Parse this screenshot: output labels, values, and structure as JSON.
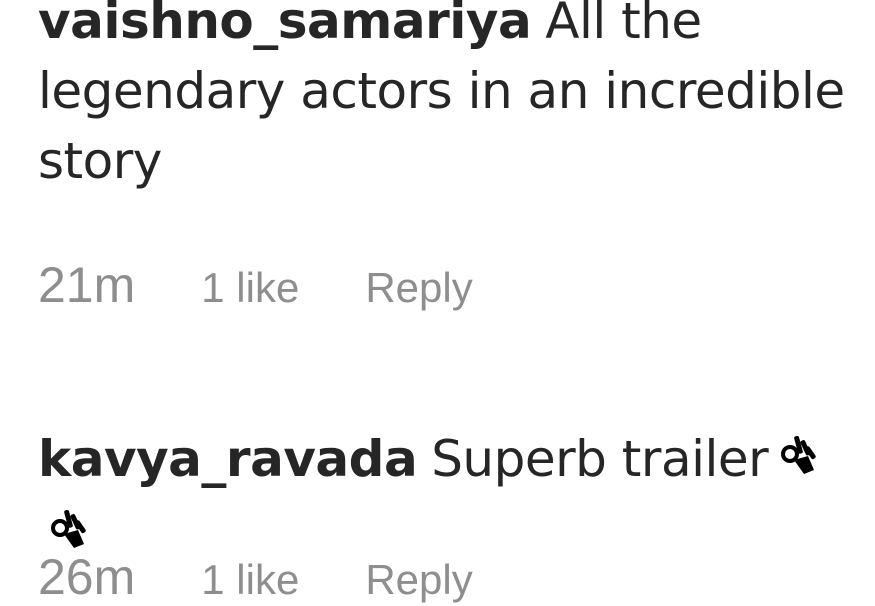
{
  "comments": [
    {
      "username": "vaishno_samariya",
      "text": "All the legendary actors in an incredible story",
      "time": "21m",
      "likes": "1 like",
      "reply": "Reply"
    },
    {
      "username": "kavya_ravada",
      "text": "Superb trailer",
      "emoji_icons": [
        "ok-hand-icon",
        "ok-hand-icon"
      ],
      "time": "26m",
      "likes": "1 like",
      "reply": "Reply"
    }
  ],
  "colors": {
    "text": "#262626",
    "meta": "#8e8e8e"
  }
}
